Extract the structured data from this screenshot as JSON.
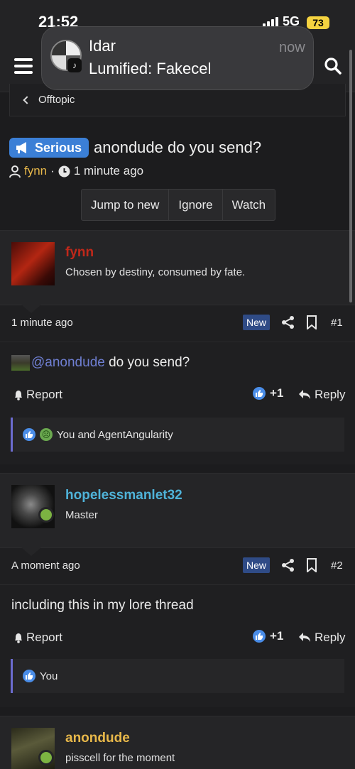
{
  "status": {
    "time": "21:52",
    "network": "5G",
    "battery": "73"
  },
  "notification": {
    "title": "Idar",
    "time": "now",
    "message": "Lumified: Fakecel"
  },
  "breadcrumb": {
    "label": "Offtopic"
  },
  "thread": {
    "prefix": "Serious",
    "title": "anondude do you send?",
    "author": "fynn",
    "separator": "·",
    "time": "1 minute ago",
    "buttons": [
      "Jump to new",
      "Ignore",
      "Watch"
    ]
  },
  "posts": [
    {
      "username": "fynn",
      "user_title": "Chosen by destiny, consumed by fate.",
      "time": "1 minute ago",
      "badge": "New",
      "number": "#1",
      "mention": "@anondude",
      "text": " do you send?",
      "report": "Report",
      "likes": "+1",
      "reply": "Reply",
      "reactions": "You and AgentAngularity"
    },
    {
      "username": "hopelessmanlet32",
      "user_title": "Master",
      "time": "A moment ago",
      "badge": "New",
      "number": "#2",
      "text": "including this in my lore thread",
      "report": "Report",
      "likes": "+1",
      "reply": "Reply",
      "reactions": "You"
    },
    {
      "username": "anondude",
      "user_title": "pisscell for the moment"
    }
  ],
  "colors": {
    "background": "#1c1c1e",
    "accent_blue": "#3b7fd6",
    "author_gold": "#e8b84a",
    "username_cyan": "#4fb3d9",
    "mention": "#6f7fd3",
    "new_badge": "#2f4b86",
    "online_green": "#7cb342"
  }
}
